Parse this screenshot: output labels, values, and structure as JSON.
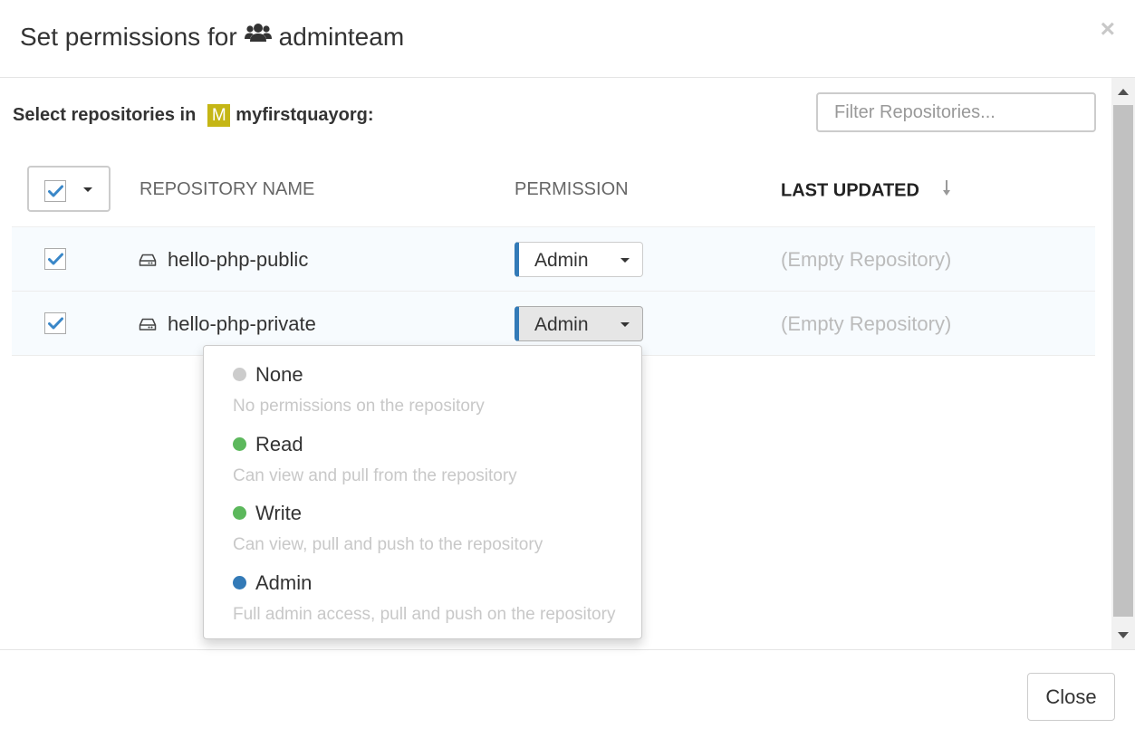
{
  "dialog": {
    "title_prefix": "Set permissions for",
    "team_name": "adminteam",
    "close_symbol": "×"
  },
  "org": {
    "select_label": "Select repositories in",
    "avatar_letter": "M",
    "name": "myfirstquayorg:",
    "avatar_color": "#c5b615"
  },
  "filter": {
    "placeholder": "Filter Repositories..."
  },
  "table": {
    "columns": {
      "repository_name": "REPOSITORY NAME",
      "permission": "PERMISSION",
      "last_updated": "LAST UPDATED"
    },
    "rows": [
      {
        "checked": true,
        "name": "hello-php-public",
        "permission": "Admin",
        "last_updated": "(Empty Repository)"
      },
      {
        "checked": true,
        "name": "hello-php-private",
        "permission": "Admin",
        "last_updated": "(Empty Repository)"
      }
    ]
  },
  "permission_menu": {
    "options": [
      {
        "name": "None",
        "description": "No permissions on the repository",
        "color": "#cccccc"
      },
      {
        "name": "Read",
        "description": "Can view and pull from the repository",
        "color": "#5cb85c"
      },
      {
        "name": "Write",
        "description": "Can view, pull and push to the repository",
        "color": "#5cb85c"
      },
      {
        "name": "Admin",
        "description": "Full admin access, pull and push on the repository",
        "color": "#337ab7"
      }
    ]
  },
  "icons": {
    "team": "users-icon",
    "repo": "hdd-icon",
    "check": "check-icon",
    "sort": "sort-down-arrow-icon",
    "close": "close-icon"
  },
  "footer": {
    "close_label": "Close"
  }
}
